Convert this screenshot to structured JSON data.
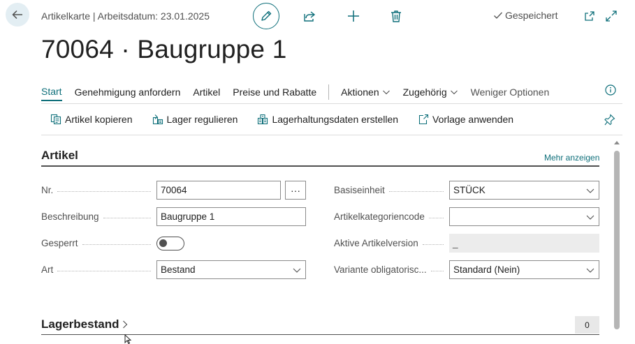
{
  "header": {
    "context": "Artikelkarte | Arbeitsdatum: 23.01.2025",
    "status": "Gespeichert",
    "title": "70064 · Baugruppe 1"
  },
  "tabs": [
    {
      "label": "Start",
      "active": true
    },
    {
      "label": "Genehmigung anfordern"
    },
    {
      "label": "Artikel"
    },
    {
      "label": "Preise und Rabatte"
    },
    {
      "label": "Aktionen"
    },
    {
      "label": "Zugehörig"
    },
    {
      "label": "Weniger Optionen"
    }
  ],
  "actions": [
    {
      "label": "Artikel kopieren",
      "icon": "copy-item-icon"
    },
    {
      "label": "Lager regulieren",
      "icon": "adjust-inventory-icon"
    },
    {
      "label": "Lagerhaltungsdaten erstellen",
      "icon": "create-stockkeeping-icon"
    },
    {
      "label": "Vorlage anwenden",
      "icon": "apply-template-icon"
    }
  ],
  "section": {
    "title": "Artikel",
    "more": "Mehr anzeigen"
  },
  "fields_left": {
    "nr": {
      "label": "Nr.",
      "value": "70064"
    },
    "beschreibung": {
      "label": "Beschreibung",
      "value": "Baugruppe 1"
    },
    "gesperrt": {
      "label": "Gesperrt",
      "value": false
    },
    "art": {
      "label": "Art",
      "value": "Bestand"
    }
  },
  "fields_right": {
    "basiseinheit": {
      "label": "Basiseinheit",
      "value": "STÜCK"
    },
    "kategorie": {
      "label": "Artikelkategoriencode",
      "value": ""
    },
    "version": {
      "label": "Aktive Artikelversion",
      "value": "_"
    },
    "variante": {
      "label": "Variante obligatorisc...",
      "value": "Standard (Nein)"
    }
  },
  "section2": {
    "title": "Lagerbestand",
    "count": "0"
  },
  "colors": {
    "accent": "#0e6f7a",
    "text": "#212121",
    "muted": "#505050"
  }
}
